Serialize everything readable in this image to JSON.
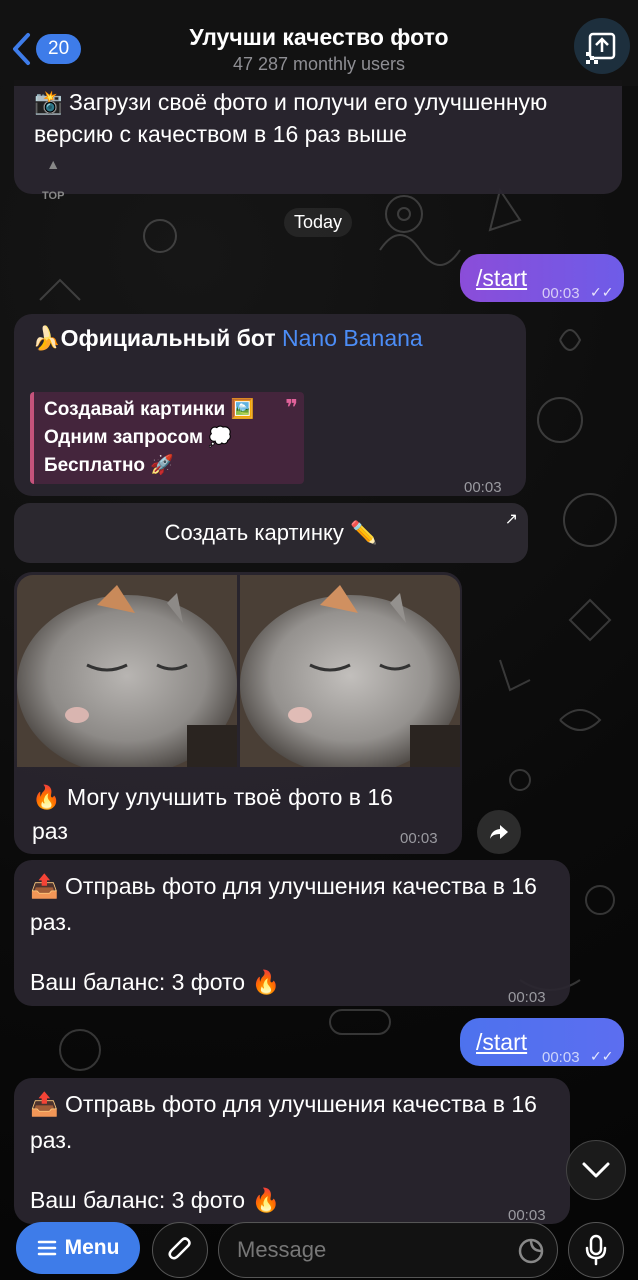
{
  "header": {
    "back_count": "20",
    "title": "Улучши качество фото",
    "subtitle": "47 287 monthly users"
  },
  "messages": {
    "top_text": "📸 Загрузи своё фото и получи его улучшенную версию с качеством в 16 раз выше",
    "top_label": "TOP",
    "date": "Today",
    "start1": {
      "text": "/start",
      "time": "00:03"
    },
    "promo_title_emoji": "🍌",
    "promo_title": "Официальный бот ",
    "promo_brand": "Nano Banana",
    "promo_lines": [
      "Создавай картинки 🖼️",
      "Одним запросом 💭",
      "Бесплатно 🚀"
    ],
    "promo_time": "00:03",
    "button_label": "Создать картинку ✏️",
    "photo_caption": "🔥 Могу улучшить твоё фото в 16 раз",
    "photo_time": "00:03",
    "send1_line1": "📤 Отправь фото для улучшения качества в 16 раз.",
    "send1_line2": "Ваш баланс: 3 фото 🔥",
    "send1_time": "00:03",
    "start2": {
      "text": "/start",
      "time": "00:03"
    },
    "send2_line1": "📤 Отправь фото для улучшения качества в 16 раз.",
    "send2_line2": "Ваш баланс: 3 фото 🔥",
    "send2_time": "00:03"
  },
  "bottom": {
    "menu_label": "Menu",
    "input_placeholder": "Message"
  },
  "colors": {
    "accent": "#3e7ce9",
    "outgoing_purple": "#8b4dd9",
    "outgoing_blue": "#4d72ee",
    "brand_link": "#4c8df6"
  }
}
